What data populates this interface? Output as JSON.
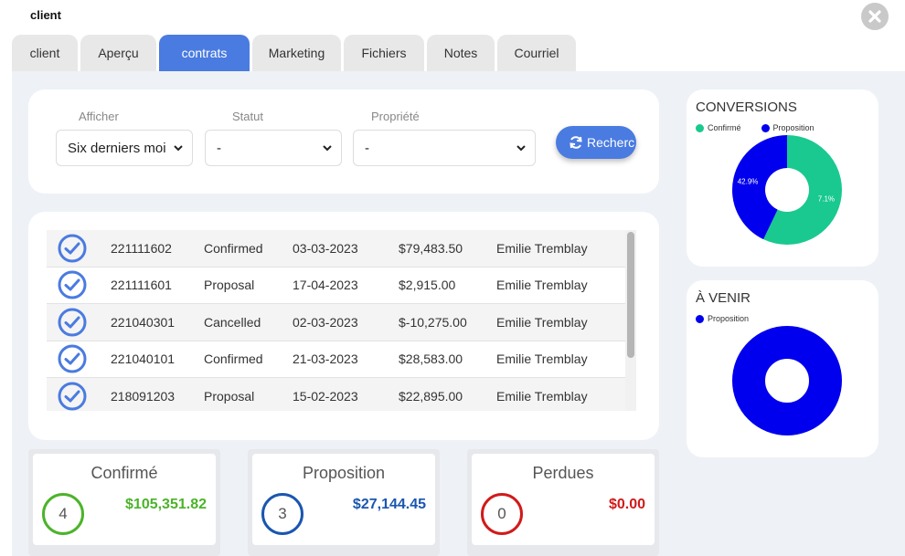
{
  "window": {
    "title": "client"
  },
  "tabs": [
    {
      "label": "client",
      "active": false
    },
    {
      "label": "Aperçu",
      "active": false
    },
    {
      "label": "contrats",
      "active": true
    },
    {
      "label": "Marketing",
      "active": false
    },
    {
      "label": "Fichiers",
      "active": false
    },
    {
      "label": "Notes",
      "active": false
    },
    {
      "label": "Courriel",
      "active": false
    }
  ],
  "filters": {
    "afficher": {
      "label": "Afficher",
      "value": "Six derniers moi"
    },
    "statut": {
      "label": "Statut",
      "value": "-"
    },
    "propriete": {
      "label": "Propriété",
      "value": "-"
    },
    "search_label": "Recherc"
  },
  "contracts": [
    {
      "id": "221111602",
      "status": "Confirmed",
      "date": "03-03-2023",
      "amount": "$79,483.50",
      "owner": "Emilie Tremblay"
    },
    {
      "id": "221111601",
      "status": "Proposal",
      "date": "17-04-2023",
      "amount": "$2,915.00",
      "owner": "Emilie Tremblay"
    },
    {
      "id": "221040301",
      "status": "Cancelled",
      "date": "02-03-2023",
      "amount": "$-10,275.00",
      "owner": "Emilie Tremblay"
    },
    {
      "id": "221040101",
      "status": "Confirmed",
      "date": "21-03-2023",
      "amount": "$28,583.00",
      "owner": "Emilie Tremblay"
    },
    {
      "id": "218091203",
      "status": "Proposal",
      "date": "15-02-2023",
      "amount": "$22,895.00",
      "owner": "Emilie Tremblay"
    }
  ],
  "stats": {
    "confirme": {
      "title": "Confirmé",
      "count": "4",
      "amount": "$105,351.82",
      "color": "#4cb32a"
    },
    "proposition": {
      "title": "Proposition",
      "count": "3",
      "amount": "$27,144.45",
      "color": "#1a56b0"
    },
    "perdues": {
      "title": "Perdues",
      "count": "0",
      "amount": "$0.00",
      "color": "#d11a1a"
    }
  },
  "conversions": {
    "title": "CONVERSIONS",
    "legend": [
      {
        "label": "Confirmé",
        "color": "#19c98f"
      },
      {
        "label": "Proposition",
        "color": "#0000ee"
      }
    ],
    "slices": [
      {
        "label": "Confirmé",
        "value": 57.1,
        "text": "7.1%",
        "color": "#19c98f"
      },
      {
        "label": "Proposition",
        "value": 42.9,
        "text": "42.9%",
        "color": "#0000ee"
      }
    ]
  },
  "a_venir": {
    "title": "À VENIR",
    "legend": [
      {
        "label": "Proposition",
        "color": "#0000ee"
      }
    ],
    "slices": [
      {
        "label": "Proposition",
        "value": 100,
        "color": "#0000ee"
      }
    ]
  },
  "colors": {
    "accent": "#4a7be0",
    "check": "#4a7be0"
  }
}
